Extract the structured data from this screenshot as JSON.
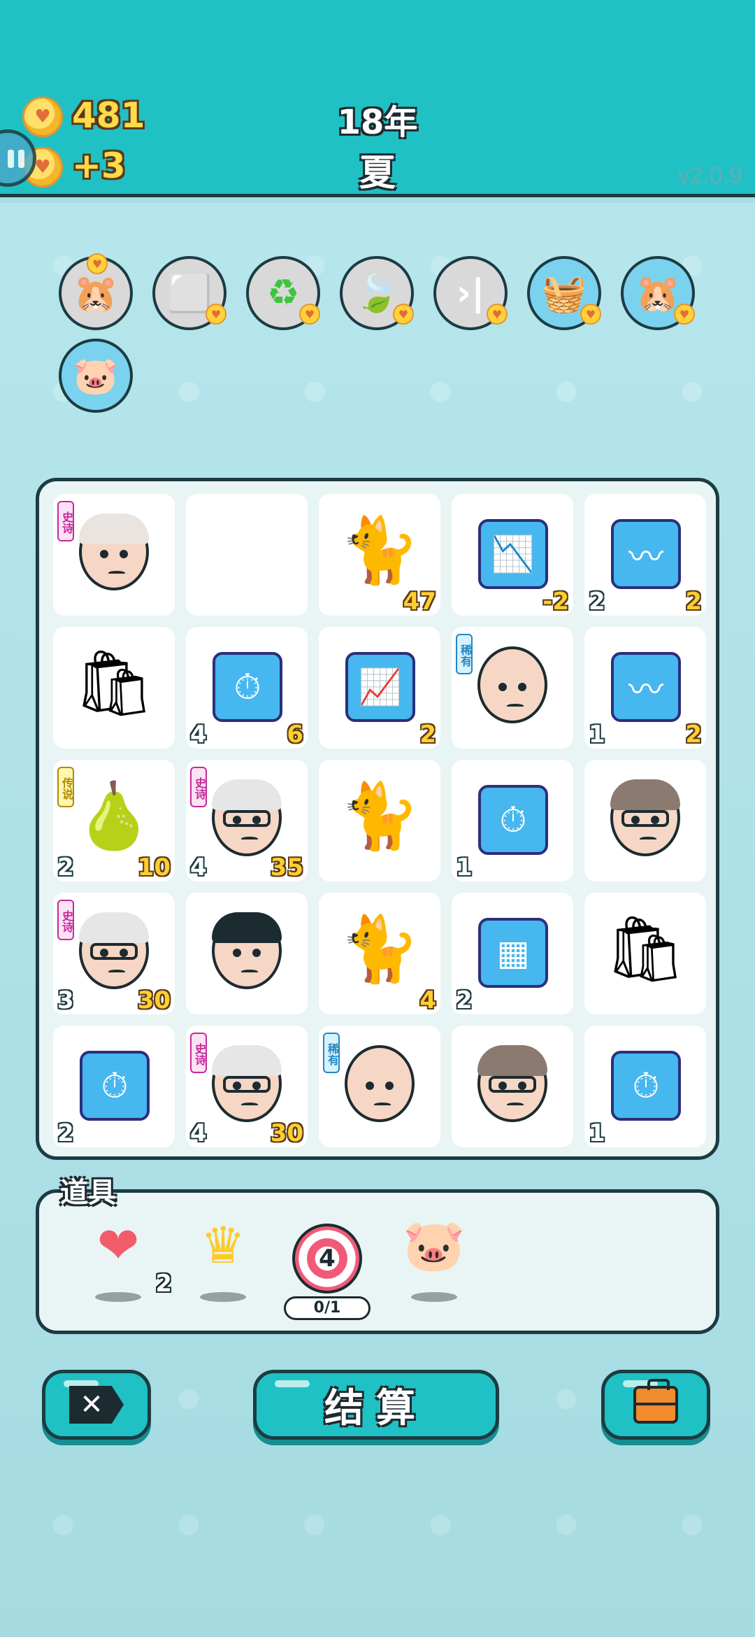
{
  "header": {
    "coins": "481",
    "income": "+3",
    "year": "18年",
    "season": "夏",
    "version": "v2.0.9"
  },
  "relics": [
    {
      "name": "hamster-pair-icon"
    },
    {
      "name": "tofu-cubes-icon"
    },
    {
      "name": "recycle-arrows-icon"
    },
    {
      "name": "leaf-icon"
    },
    {
      "name": "skip-forward-icon"
    },
    {
      "name": "fruit-basket-icon"
    },
    {
      "name": "hamster-icon"
    },
    {
      "name": "piggy-bank-icon"
    }
  ],
  "board": {
    "rows": [
      [
        {
          "type": "old-man-face",
          "tag": "史诗",
          "left": "",
          "right": ""
        },
        {
          "type": "empty",
          "tag": "",
          "left": "",
          "right": ""
        },
        {
          "type": "cat",
          "tag": "",
          "left": "",
          "right": "47"
        },
        {
          "type": "chart-down-card",
          "tag": "",
          "left": "",
          "right": "-2"
        },
        {
          "type": "trend-card",
          "tag": "",
          "left": "2",
          "right": "2"
        }
      ],
      [
        {
          "type": "garbage-bag",
          "tag": "",
          "left": "",
          "right": ""
        },
        {
          "type": "stopwatch-card",
          "tag": "",
          "left": "4",
          "right": "6"
        },
        {
          "type": "chart-up-card",
          "tag": "",
          "left": "",
          "right": "2"
        },
        {
          "type": "bald-man-face",
          "tag": "稀有",
          "left": "",
          "right": ""
        },
        {
          "type": "trend-card",
          "tag": "",
          "left": "1",
          "right": "2"
        }
      ],
      [
        {
          "type": "pear",
          "tag": "传说",
          "left": "2",
          "right": "10"
        },
        {
          "type": "grandpa-face",
          "tag": "史诗",
          "left": "4",
          "right": "35"
        },
        {
          "type": "cat",
          "tag": "",
          "left": "",
          "right": ""
        },
        {
          "type": "stopwatch-card",
          "tag": "",
          "left": "1",
          "right": ""
        },
        {
          "type": "glasses-man-face",
          "tag": "",
          "left": "",
          "right": ""
        }
      ],
      [
        {
          "type": "grandpa-face",
          "tag": "史诗",
          "left": "3",
          "right": "30"
        },
        {
          "type": "young-man-face",
          "tag": "",
          "left": "",
          "right": ""
        },
        {
          "type": "cat",
          "tag": "",
          "left": "",
          "right": "4"
        },
        {
          "type": "gold-bars-card",
          "tag": "",
          "left": "2",
          "right": ""
        },
        {
          "type": "garbage-bag",
          "tag": "",
          "left": "",
          "right": ""
        }
      ],
      [
        {
          "type": "stopwatch-card",
          "tag": "",
          "left": "2",
          "right": ""
        },
        {
          "type": "grandpa-face",
          "tag": "史诗",
          "left": "4",
          "right": "30"
        },
        {
          "type": "bald-man-face",
          "tag": "稀有",
          "left": "",
          "right": ""
        },
        {
          "type": "glasses-man-face",
          "tag": "",
          "left": "",
          "right": ""
        },
        {
          "type": "stopwatch-card",
          "tag": "",
          "left": "1",
          "right": ""
        }
      ]
    ]
  },
  "items": {
    "title": "道具",
    "liver_count": "2",
    "target_value": "4",
    "target_uses": "0/1"
  },
  "buttons": {
    "exit_glyph": "✕",
    "settle_label": "结算"
  },
  "colors": {
    "header": "#20c1c4",
    "background": "#a9dde3",
    "outline": "#1c3b42",
    "card_blue": "#46b7ef",
    "number_gold": "#ffcf2f"
  }
}
